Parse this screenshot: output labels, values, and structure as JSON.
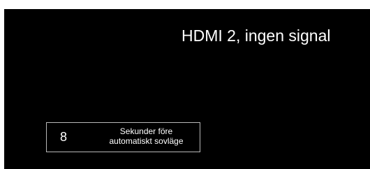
{
  "screen": {
    "background_color": "#000000",
    "title": "HDMI 2, ingen signal"
  },
  "sleep_timer": {
    "seconds": "8",
    "label_line1": "Sekunder före",
    "label_line2": "automatiskt sovläge"
  }
}
